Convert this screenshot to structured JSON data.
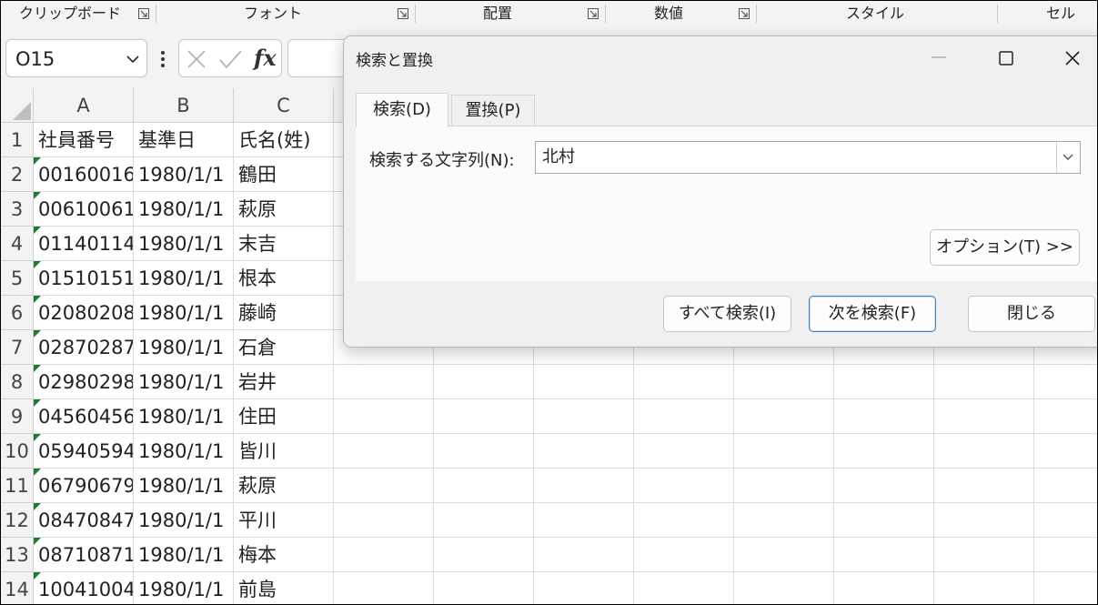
{
  "ribbon": {
    "groups": [
      "クリップボード",
      "フォント",
      "配置",
      "数値",
      "スタイル",
      "セル"
    ]
  },
  "formula_bar": {
    "name_box": "O15",
    "fx_label": "fx",
    "formula": ""
  },
  "sheet": {
    "columns": [
      "A",
      "B",
      "C"
    ],
    "rows": [
      {
        "num": "1",
        "a": "社員番号",
        "b": "基準日",
        "c": "氏名(姓)"
      },
      {
        "num": "2",
        "a": "00160016",
        "b": "1980/1/1",
        "c": "鶴田"
      },
      {
        "num": "3",
        "a": "00610061",
        "b": "1980/1/1",
        "c": "萩原"
      },
      {
        "num": "4",
        "a": "01140114",
        "b": "1980/1/1",
        "c": "末吉"
      },
      {
        "num": "5",
        "a": "01510151",
        "b": "1980/1/1",
        "c": "根本"
      },
      {
        "num": "6",
        "a": "02080208",
        "b": "1980/1/1",
        "c": "藤崎"
      },
      {
        "num": "7",
        "a": "02870287",
        "b": "1980/1/1",
        "c": "石倉"
      },
      {
        "num": "8",
        "a": "02980298",
        "b": "1980/1/1",
        "c": "岩井"
      },
      {
        "num": "9",
        "a": "04560456",
        "b": "1980/1/1",
        "c": "住田"
      },
      {
        "num": "10",
        "a": "05940594",
        "b": "1980/1/1",
        "c": "皆川"
      },
      {
        "num": "11",
        "a": "06790679",
        "b": "1980/1/1",
        "c": "萩原"
      },
      {
        "num": "12",
        "a": "08470847",
        "b": "1980/1/1",
        "c": "平川"
      },
      {
        "num": "13",
        "a": "08710871",
        "b": "1980/1/1",
        "c": "梅本"
      },
      {
        "num": "14",
        "a": "10041004",
        "b": "1980/1/1",
        "c": "前島"
      }
    ]
  },
  "dialog": {
    "title": "検索と置換",
    "tabs": [
      "検索(D)",
      "置換(P)"
    ],
    "find_label": "検索する文字列(N):",
    "find_value": "北村",
    "options_button": "オプション(T) >>",
    "find_all_button": "すべて検索(I)",
    "find_next_button": "次を検索(F)",
    "close_button": "閉じる"
  },
  "colors": {
    "ribbon_bg": "#f3f3f3",
    "error_triangle": "#1e7b34",
    "primary_border": "#3b7fc4",
    "dialog_bg": "#f0f0f0"
  }
}
